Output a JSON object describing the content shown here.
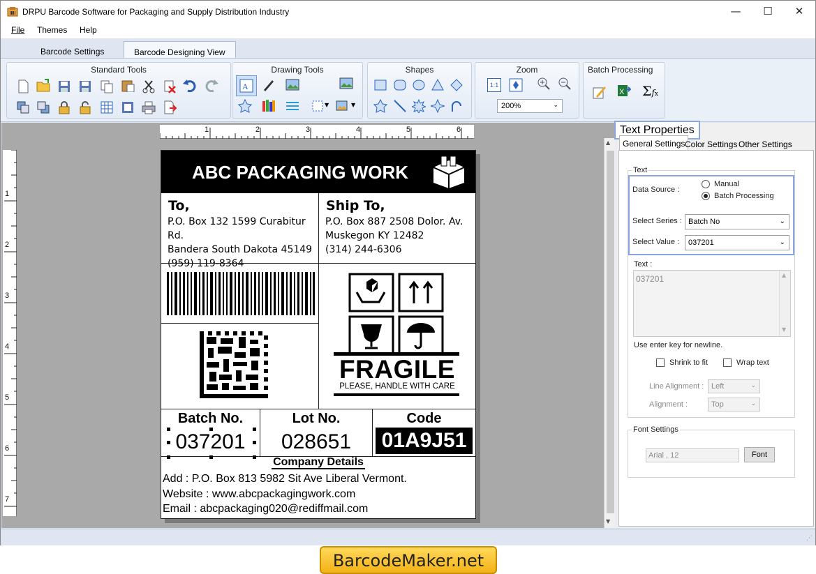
{
  "window": {
    "title": "DRPU Barcode Software for Packaging and Supply Distribution Industry",
    "minimize": "—",
    "maximize": "☐",
    "close": "✕"
  },
  "menu": [
    "File",
    "Themes",
    "Help"
  ],
  "tabs": [
    "Barcode Settings",
    "Barcode Designing View"
  ],
  "ribbon": {
    "standard_tools": "Standard Tools",
    "drawing_tools": "Drawing Tools",
    "shapes": "Shapes",
    "zoom": "Zoom",
    "zoom_value": "200%",
    "zoom_fit": "1:1",
    "batch_processing": "Batch Processing"
  },
  "ruler": {
    "h": [
      "1",
      "2",
      "3",
      "4",
      "5",
      "6"
    ],
    "v": [
      "1",
      "2",
      "3",
      "4",
      "5",
      "6",
      "7"
    ]
  },
  "label": {
    "header": "ABC PACKAGING WORK",
    "to": {
      "title": "To,",
      "lines": [
        "P.O. Box 132 1599 Curabitur Rd.",
        "Bandera South Dakota 45149",
        "(959) 119-8364"
      ]
    },
    "ship": {
      "title": "Ship To,",
      "lines": [
        "P.O. Box 887 2508 Dolor. Av.",
        "Muskegon KY 12482",
        "(314) 244-6306"
      ]
    },
    "fragile": "FRAGILE",
    "fragile_sub": "PLEASE, HANDLE WITH CARE",
    "batch": {
      "label": "Batch No.",
      "value": "037201"
    },
    "lot": {
      "label": "Lot No.",
      "value": "028651"
    },
    "code": {
      "label": "Code",
      "value": "01A9J51"
    },
    "company": {
      "title": "Company Details",
      "address": "Add : P.O. Box 813 5982 Sit Ave Liberal Vermont.",
      "website": "Website : www.abcpackagingwork.com",
      "email": "Email : abcpackaging020@rediffmail.com"
    }
  },
  "panel": {
    "title": "Text Properties",
    "tabs": [
      "General Settings",
      "Color Settings",
      "Other Settings"
    ],
    "text_group": "Text",
    "data_source_label": "Data Source :",
    "manual": "Manual",
    "batch_processing": "Batch Processing",
    "selected_source": "Batch Processing",
    "select_series_label": "Select Series :",
    "select_series_value": "Batch No",
    "select_value_label": "Select Value :",
    "select_value_value": "037201",
    "text_label": "Text :",
    "text_value": "037201",
    "hint": "Use enter key for newline.",
    "shrink": "Shrink to fit",
    "wrap": "Wrap text",
    "line_align_label": "Line Alignment :",
    "line_align_value": "Left",
    "align_label": "Alignment :",
    "align_value": "Top",
    "font_group": "Font Settings",
    "font_value": "Arial , 12",
    "font_button": "Font"
  },
  "brand": "BarcodeMaker.net",
  "colors": {
    "accent": "#89a7da",
    "ribbon": "#eaf0f8",
    "canvas": "#a9a9a9",
    "brand": "#f3b217"
  }
}
